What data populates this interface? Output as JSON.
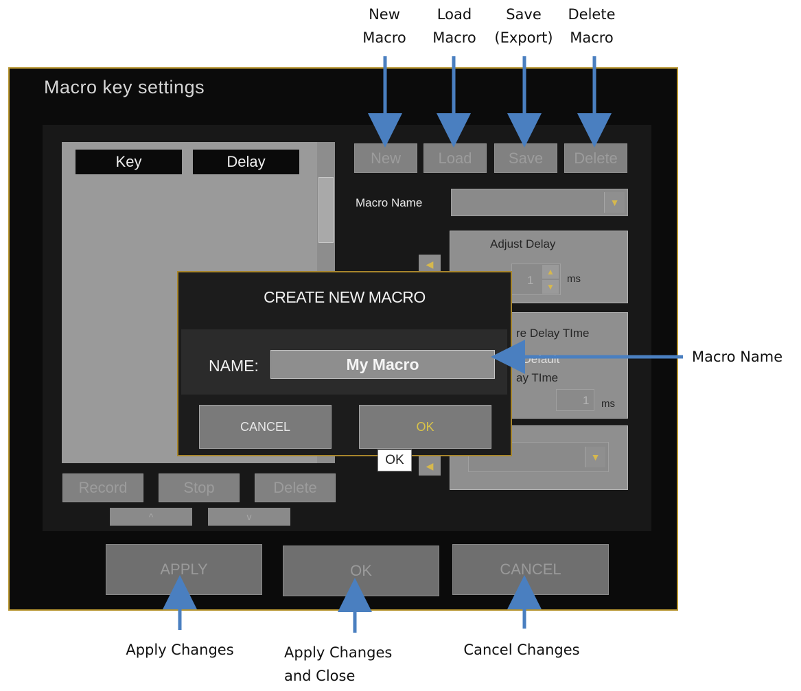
{
  "annotations": {
    "top": [
      "New\nMacro",
      "Load\nMacro",
      "Save\n(Export)",
      "Delete\nMacro"
    ],
    "right": "Macro Name",
    "bottom": [
      "Apply Changes",
      "Apply Changes\nand Close",
      "Cancel Changes"
    ]
  },
  "window": {
    "title": "Macro key settings",
    "columns": [
      "Key",
      "Delay"
    ],
    "top_buttons": [
      "New",
      "Load",
      "Save",
      "Delete"
    ],
    "macro_name_label": "Macro Name",
    "adjust_delay": {
      "title": "Adjust Delay",
      "value": "1",
      "unit": "ms"
    },
    "record_panel": {
      "line1": "re Delay TIme",
      "line2": "t Default",
      "line3": "ay TIme",
      "value": "1",
      "unit": "ms"
    },
    "list_buttons": [
      "Record",
      "Stop",
      "Delete"
    ],
    "move_buttons": [
      "^",
      "v"
    ],
    "bottom_buttons": [
      "APPLY",
      "OK",
      "CANCEL"
    ],
    "colors": {
      "frame": "#b8952f",
      "dropdown_arrow": "#d6b84d",
      "arrow": "#4a7fc0"
    }
  },
  "dialog": {
    "title": "CREATE NEW MACRO",
    "name_label": "NAME:",
    "name_value": "My Macro",
    "cancel": "CANCEL",
    "ok": "OK",
    "tooltip": "OK"
  }
}
